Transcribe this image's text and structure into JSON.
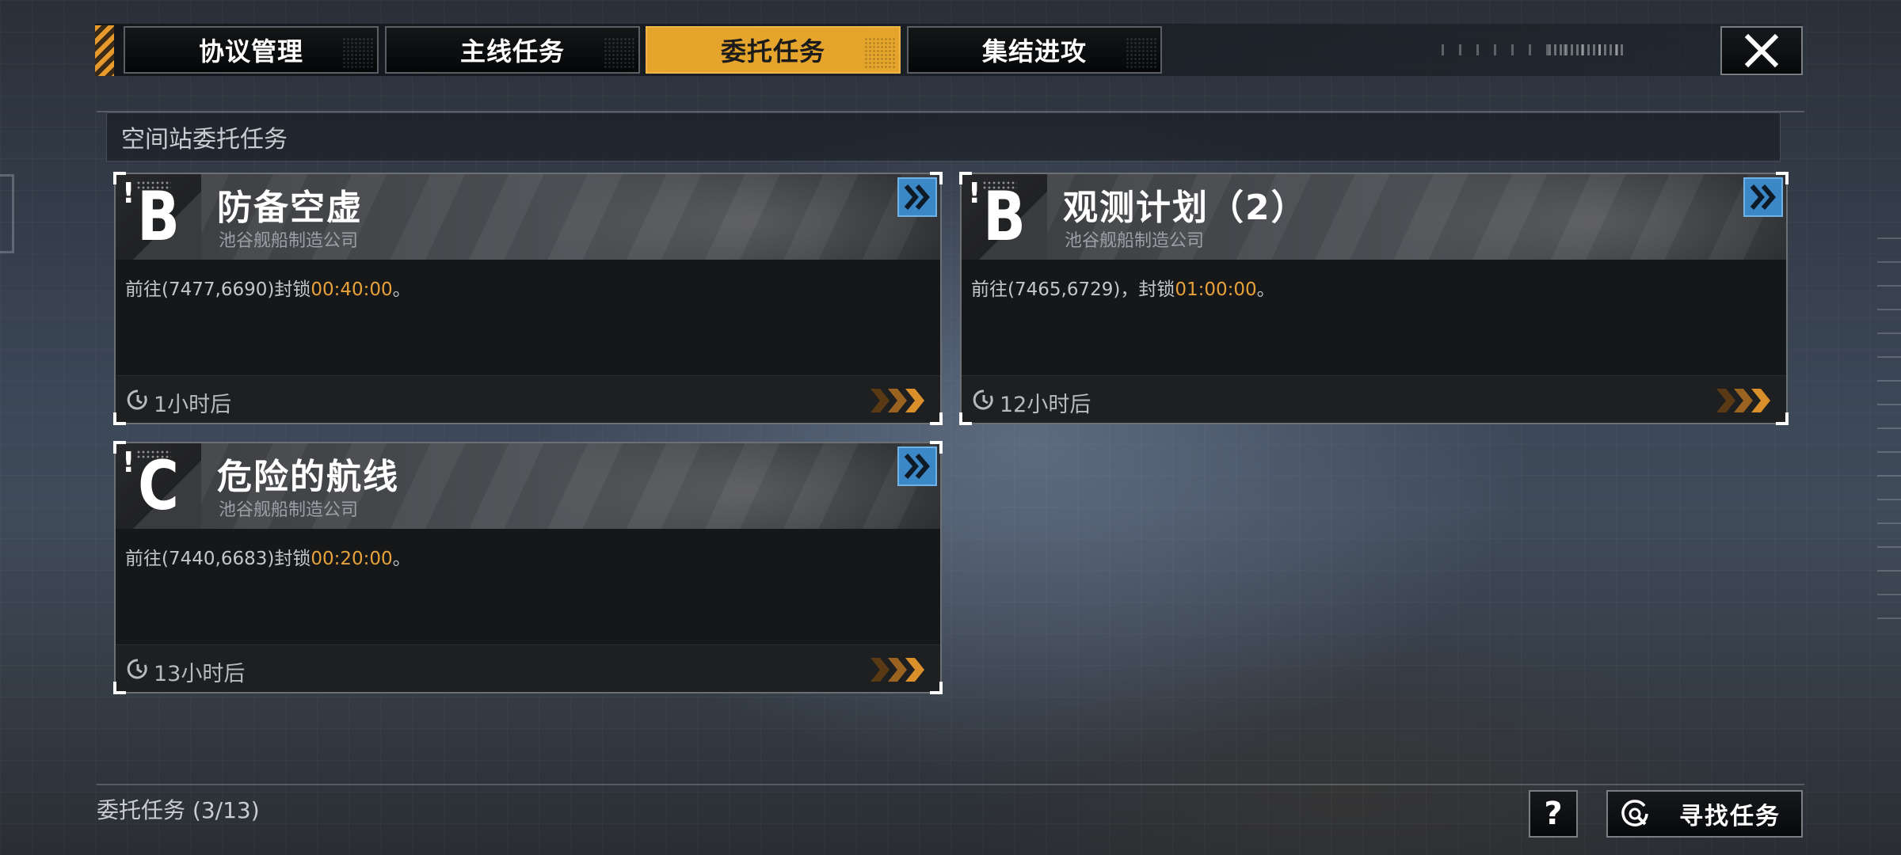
{
  "tabs": [
    {
      "label": "协议管理",
      "active": false
    },
    {
      "label": "主线任务",
      "active": false
    },
    {
      "label": "委托任务",
      "active": true
    },
    {
      "label": "集结进攻",
      "active": false
    }
  ],
  "section_title": "空间站委托任务",
  "missions": [
    {
      "grade": "B",
      "title": "防备空虚",
      "company": "池谷舰船制造公司",
      "desc_prefix": "前往(7477,6690)封锁",
      "desc_time": "00:40:00",
      "desc_suffix": "。",
      "remaining": "1小时后"
    },
    {
      "grade": "B",
      "title": "观测计划（2）",
      "company": "池谷舰船制造公司",
      "desc_prefix": "前往(7465,6729)，封锁",
      "desc_time": "01:00:00",
      "desc_suffix": "。",
      "remaining": "12小时后"
    },
    {
      "grade": "C",
      "title": "危险的航线",
      "company": "池谷舰船制造公司",
      "desc_prefix": "前往(7440,6683)封锁",
      "desc_time": "00:20:00",
      "desc_suffix": "。",
      "remaining": "13小时后"
    }
  ],
  "counter": "委托任务 (3/13)",
  "help_label": "?",
  "find_button": "寻找任务",
  "icons": {
    "close": "close-icon",
    "go": "double-chevron-right-icon",
    "clock": "clock-icon",
    "chevrons": "triple-chevron-icon",
    "search": "search-target-icon"
  },
  "colors": {
    "accent": "#e5a42c",
    "time_highlight": "#e8a23a",
    "go_button": "#3c87c6"
  }
}
